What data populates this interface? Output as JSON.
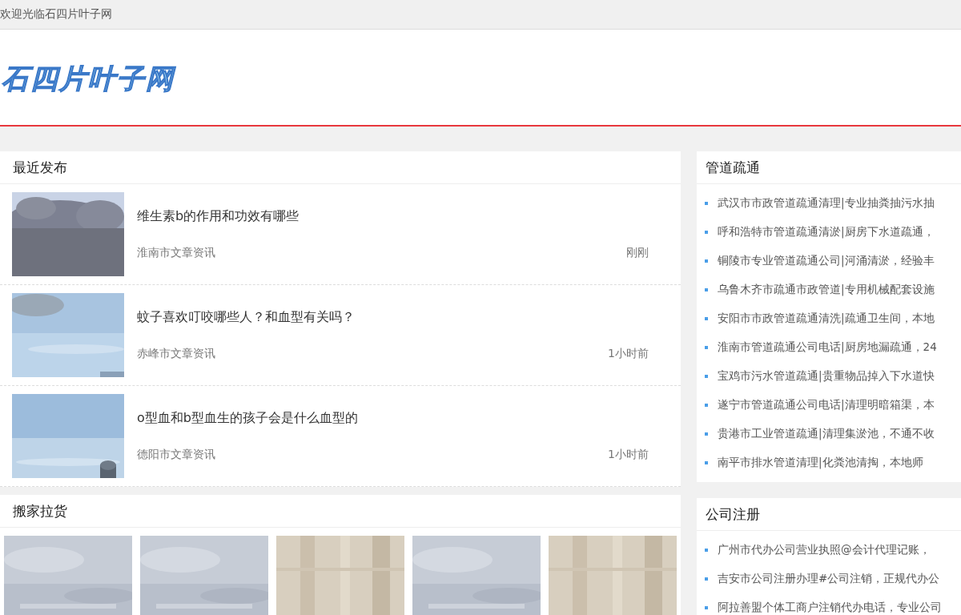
{
  "top_bar": {
    "welcome": "欢迎光临石四片叶子网"
  },
  "header": {
    "logo": "石四片叶子网"
  },
  "recent": {
    "title": "最近发布",
    "articles": [
      {
        "title": "维生素b的作用和功效有哪些",
        "source": "淮南市文章资讯",
        "time": "刚刚"
      },
      {
        "title": "蚊子喜欢叮咬哪些人？和血型有关吗？",
        "source": "赤峰市文章资讯",
        "time": "1小时前"
      },
      {
        "title": "o型血和b型血生的孩子会是什么血型的",
        "source": "德阳市文章资讯",
        "time": "1小时前"
      }
    ]
  },
  "moving": {
    "title": "搬家拉货"
  },
  "sidebar": [
    {
      "title": "管道疏通",
      "items": [
        "武汉市市政管道疏通清理|专业抽粪抽污水抽",
        "呼和浩特市管道疏通清淤|厨房下水道疏通，",
        "铜陵市专业管道疏通公司|河涌清淤，经验丰",
        "乌鲁木齐市疏通市政管道|专用机械配套设施",
        "安阳市市政管道疏通清洗|疏通卫生间，本地",
        "淮南市管道疏通公司电话|厨房地漏疏通，24",
        "宝鸡市污水管道疏通|贵重物品掉入下水道快",
        "遂宁市管道疏通公司电话|清理明暗箱渠，本",
        "贵港市工业管道疏通|清理集淤池，不通不收",
        "南平市排水管道清理|化粪池清掏，本地师"
      ]
    },
    {
      "title": "公司注册",
      "items": [
        "广州市代办公司营业执照@会计代理记账，",
        "吉安市公司注册办理#公司注销，正规代办公",
        "阿拉善盟个体工商户注销代办电话，专业公司"
      ]
    }
  ]
}
